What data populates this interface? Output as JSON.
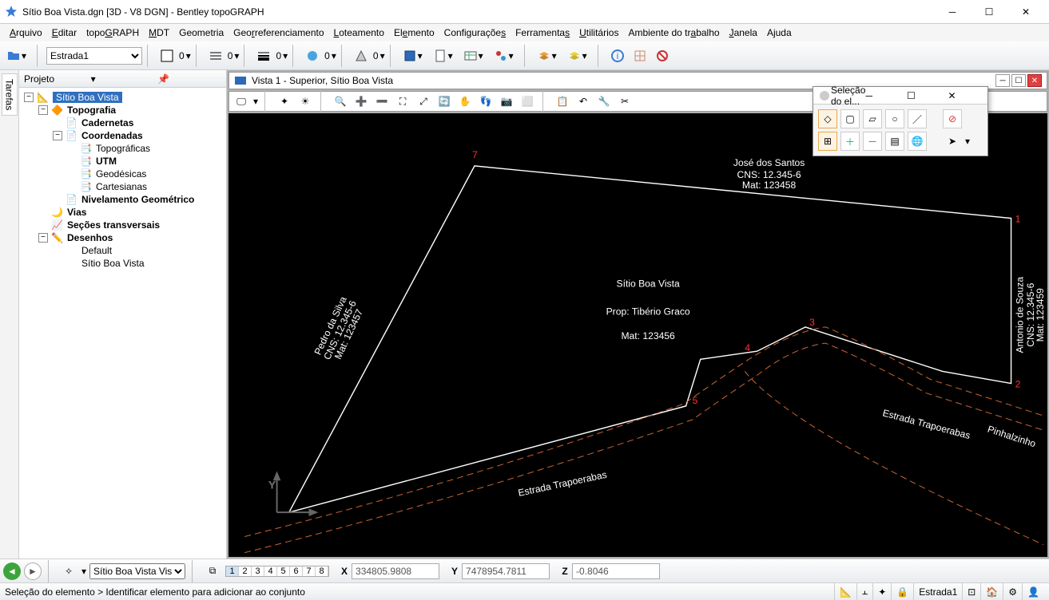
{
  "app": {
    "title": "Sítio Boa Vista.dgn [3D - V8 DGN] - Bentley topoGRAPH",
    "float_title": "Seleção do el..."
  },
  "menu": [
    "Arquivo",
    "Editar",
    "topoGRAPH",
    "MDT",
    "Geometria",
    "Georreferenciamento",
    "Loteamento",
    "Elemento",
    "Configurações",
    "Ferramentas",
    "Utilitários",
    "Ambiente do trabalho",
    "Janela",
    "Ajuda"
  ],
  "toolbar": {
    "level_select": "Estrada1",
    "val1": "0",
    "val2": "0",
    "val3": "0",
    "val4": "0",
    "val5": "0"
  },
  "sidetab": "Tarefas",
  "project": {
    "title": "Projeto",
    "root": "Sítio Boa Vista",
    "topo": "Topografia",
    "cad": "Cadernetas",
    "coord": "Coordenadas",
    "topog": "Topográficas",
    "utm": "UTM",
    "geo": "Geodésicas",
    "cart": "Cartesianas",
    "nivel": "Nivelamento Geométrico",
    "vias": "Vias",
    "sec": "Seções transversais",
    "des": "Desenhos",
    "def": "Default",
    "sbv": "Sítio Boa Vista"
  },
  "view": {
    "title": "Vista 1 - Superior, Sítio Boa Vista"
  },
  "drawing": {
    "title": "Sítio Boa Vista",
    "prop": "Prop: Tibério Graco",
    "mat": "Mat: 123456",
    "n1": {
      "name": "José dos Santos",
      "cns": "CNS: 12.345-6",
      "mat": "Mat: 123458"
    },
    "n2": {
      "name": "Antonio de Souza",
      "cns": "CNS: 12.345-6",
      "mat": "Mat: 123459"
    },
    "n3": {
      "name": "Pedro da Silva",
      "cns": "CNS: 12.345-6",
      "mat": "Mat: 123457"
    },
    "road": "Estrada Trapoerabas",
    "road2": "Estrada Trapoerabas",
    "pin": "Pinhalzinho",
    "pts": {
      "p1": "1",
      "p2": "2",
      "p3": "3",
      "p4": "4",
      "p5": "5",
      "p7": "7"
    }
  },
  "nav": {
    "view_select": "Sítio Boa Vista Vis",
    "nums": [
      "1",
      "2",
      "3",
      "4",
      "5",
      "6",
      "7",
      "8"
    ],
    "x_label": "X",
    "x": "334805.9808",
    "y_label": "Y",
    "y": "7478954.7811",
    "z_label": "Z",
    "z": "-0.8046"
  },
  "status": {
    "msg": "Seleção do elemento > Identificar elemento para adicionar ao conjunto",
    "level": "Estrada1"
  }
}
